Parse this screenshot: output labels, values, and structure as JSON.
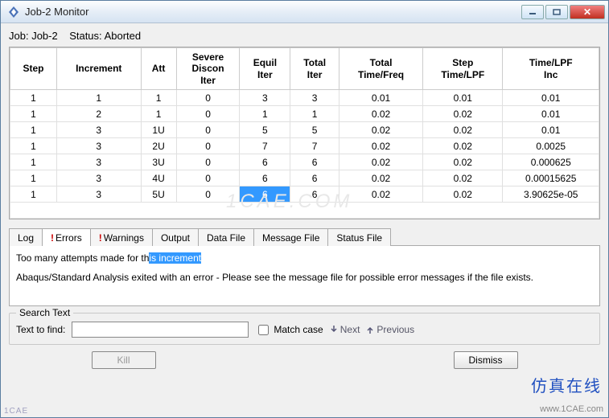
{
  "title": "Job-2 Monitor",
  "status_line": {
    "job_label": "Job:",
    "job_name": "Job-2",
    "status_label": "Status:",
    "status_value": "Aborted"
  },
  "columns": [
    "Step",
    "Increment",
    "Att",
    "Severe Discon Iter",
    "Equil Iter",
    "Total Iter",
    "Total Time/Freq",
    "Step Time/LPF",
    "Time/LPF Inc"
  ],
  "rows": [
    {
      "c": [
        "1",
        "1",
        "1",
        "0",
        "3",
        "3",
        "0.01",
        "0.01",
        "0.01"
      ]
    },
    {
      "c": [
        "1",
        "2",
        "1",
        "0",
        "1",
        "1",
        "0.02",
        "0.02",
        "0.01"
      ]
    },
    {
      "c": [
        "1",
        "3",
        "1U",
        "0",
        "5",
        "5",
        "0.02",
        "0.02",
        "0.01"
      ]
    },
    {
      "c": [
        "1",
        "3",
        "2U",
        "0",
        "7",
        "7",
        "0.02",
        "0.02",
        "0.0025"
      ]
    },
    {
      "c": [
        "1",
        "3",
        "3U",
        "0",
        "6",
        "6",
        "0.02",
        "0.02",
        "0.000625"
      ]
    },
    {
      "c": [
        "1",
        "3",
        "4U",
        "0",
        "6",
        "6",
        "0.02",
        "0.02",
        "0.00015625"
      ]
    },
    {
      "c": [
        "1",
        "3",
        "5U",
        "0",
        "6",
        "6",
        "0.02",
        "0.02",
        "3.90625e-05"
      ],
      "sel": 4
    }
  ],
  "tabs": {
    "log": "Log",
    "errors": "Errors",
    "warnings": "Warnings",
    "output": "Output",
    "datafile": "Data File",
    "msgfile": "Message File",
    "statusfile": "Status File"
  },
  "error_msg": {
    "line1a": "Too many attempts made for th",
    "line1b": "is increment",
    "line2": "Abaqus/Standard Analysis exited with an error - Please see the  message file for possible error messages if the file exists."
  },
  "search": {
    "legend": "Search Text",
    "find_label": "Text to find:",
    "value": "",
    "match_case": "Match case",
    "next": "Next",
    "previous": "Previous"
  },
  "buttons": {
    "kill": "Kill",
    "dismiss": "Dismiss"
  },
  "brand": "仿真在线",
  "watermark_url": "www.1CAE.com",
  "wm_center": "1CAE.COM",
  "logo_bl": "1CAE"
}
